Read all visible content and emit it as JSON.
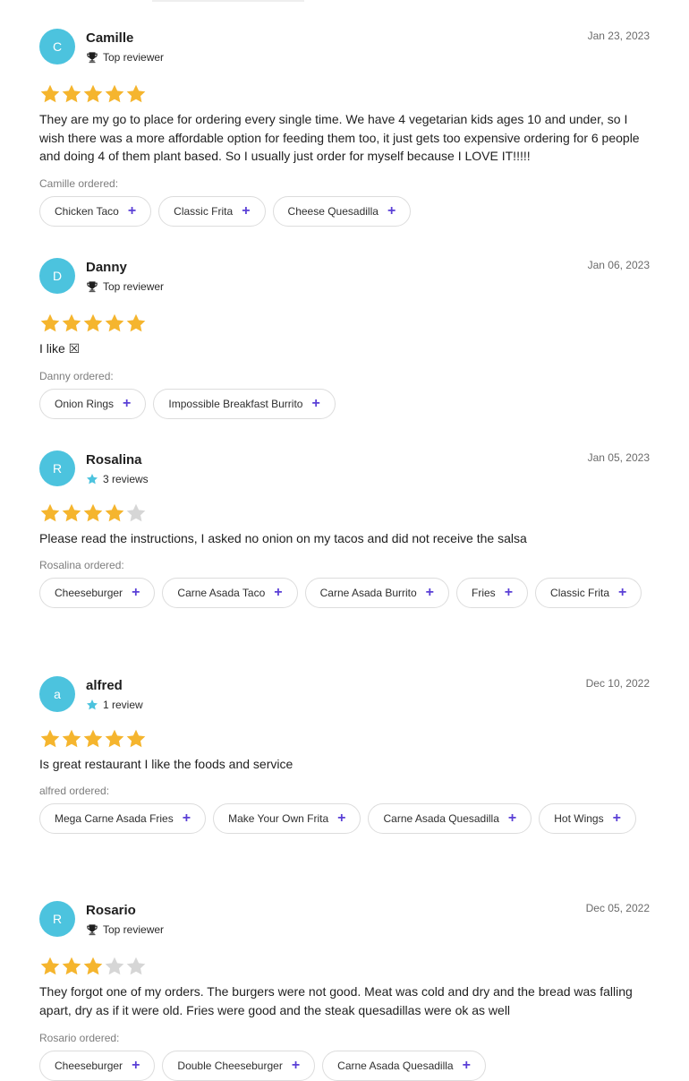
{
  "colors": {
    "avatar": "#4cc3de",
    "star_filled": "#f5b52e",
    "star_empty": "#d6d6d6",
    "plus": "#5a3fd6",
    "badge_star": "#4cc3de"
  },
  "reviews": [
    {
      "avatar_letter": "C",
      "name": "Camille",
      "badge_icon": "trophy-icon",
      "badge_text": "Top reviewer",
      "date": "Jan 23, 2023",
      "rating": 5,
      "text": "They are my go to place for ordering every single time. We have 4 vegetarian kids ages 10 and under, so I wish there was a more affordable option for feeding them too, it just gets too expensive ordering for 6 people and doing 4 of them plant based. So I usually just order for myself because I LOVE IT!!!!!",
      "ordered_label": "Camille ordered:",
      "items": [
        "Chicken Taco",
        "Classic Frita",
        "Cheese Quesadilla"
      ]
    },
    {
      "avatar_letter": "D",
      "name": "Danny",
      "badge_icon": "trophy-icon",
      "badge_text": "Top reviewer",
      "date": "Jan 06, 2023",
      "rating": 5,
      "text": "I like ☒",
      "ordered_label": "Danny ordered:",
      "items": [
        "Onion Rings",
        "Impossible Breakfast Burrito"
      ]
    },
    {
      "avatar_letter": "R",
      "name": "Rosalina",
      "badge_icon": "star-icon",
      "badge_text": "3 reviews",
      "date": "Jan 05, 2023",
      "rating": 4,
      "text": "Please read the instructions, I asked no onion on my tacos and did not receive the salsa",
      "ordered_label": "Rosalina ordered:",
      "items": [
        "Cheeseburger",
        "Carne Asada Taco",
        "Carne Asada Burrito",
        "Fries",
        "Classic Frita"
      ]
    },
    {
      "avatar_letter": "a",
      "name": "alfred",
      "badge_icon": "star-icon",
      "badge_text": "1 review",
      "date": "Dec 10, 2022",
      "rating": 5,
      "text": "Is great restaurant I like the foods and service",
      "ordered_label": "alfred ordered:",
      "items": [
        "Mega Carne Asada Fries",
        "Make Your Own Frita",
        "Carne Asada Quesadilla",
        "Hot Wings"
      ]
    },
    {
      "avatar_letter": "R",
      "name": "Rosario",
      "badge_icon": "trophy-icon",
      "badge_text": "Top reviewer",
      "date": "Dec 05, 2022",
      "rating": 3,
      "text": "They forgot one of my orders. The burgers were not good. Meat was cold and dry and the bread was falling apart, dry as if it were old. Fries were good and the steak quesadillas were ok as well",
      "ordered_label": "Rosario ordered:",
      "items": [
        "Cheeseburger",
        "Double Cheeseburger",
        "Carne Asada Quesadilla"
      ]
    }
  ]
}
